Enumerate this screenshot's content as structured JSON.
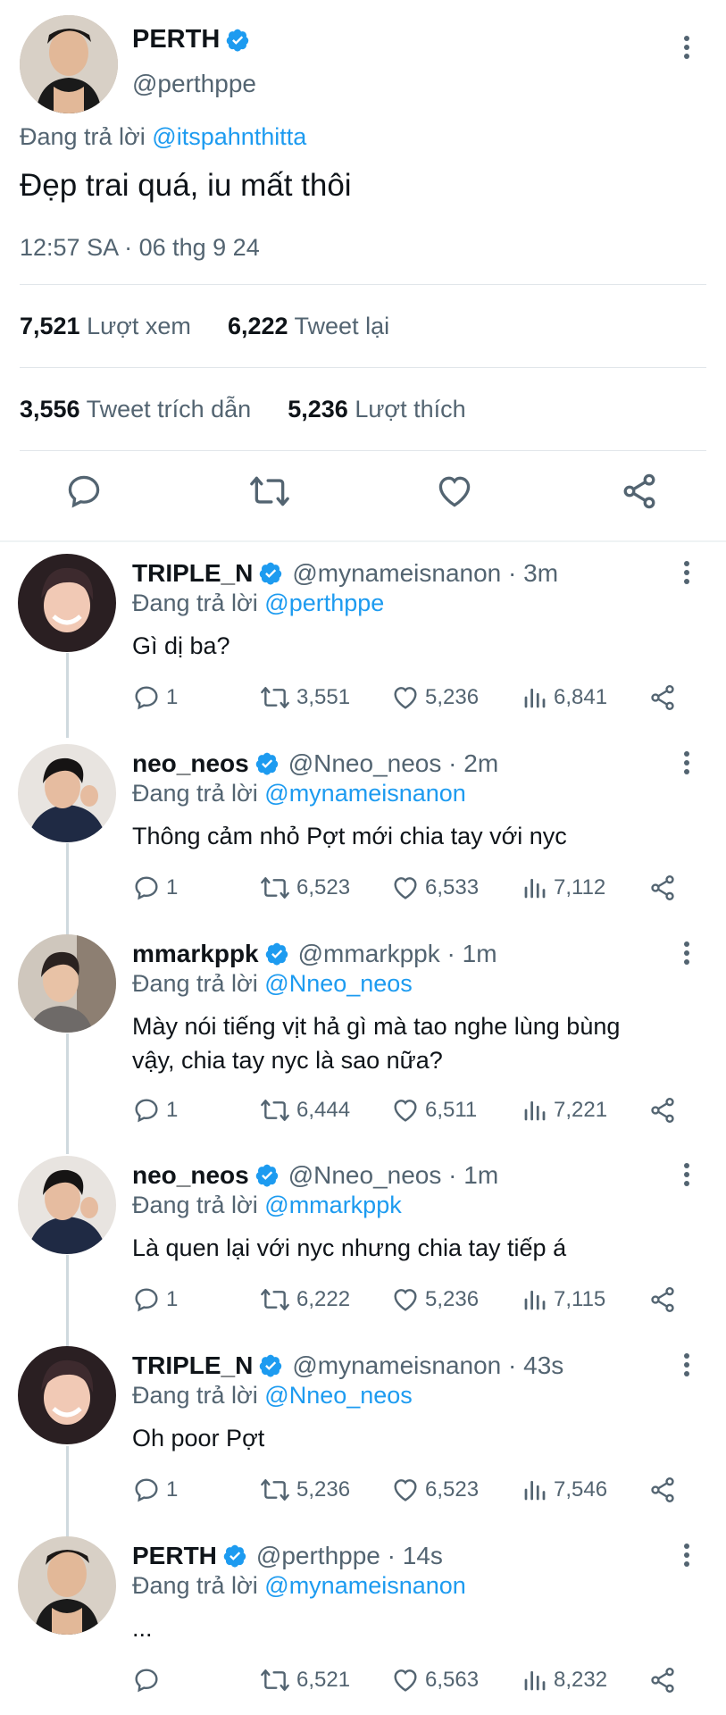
{
  "main": {
    "name": "PERTH",
    "handle": "@perthppe",
    "replying_prefix": "Đang trả lời",
    "replying_to": "@itspahnthitta",
    "text": "Đẹp trai quá, iu mất thôi",
    "timestamp": "12:57 SA · 06 thg 9 24",
    "views_count": "7,521",
    "views_label": "Lượt xem",
    "retweets_count": "6,222",
    "retweets_label": "Tweet lại",
    "quotes_count": "3,556",
    "quotes_label": "Tweet trích dẫn",
    "likes_count": "5,236",
    "likes_label": "Lượt thích"
  },
  "replies": [
    {
      "name": "TRIPLE_N",
      "handle": "@mynameisnanon",
      "time": "· 3m",
      "replying_prefix": "Đang trả lời",
      "replying_to": "@perthppe",
      "text": "Gì dị ba?",
      "comments": "1",
      "retweets": "3,551",
      "likes": "5,236",
      "views": "6,841"
    },
    {
      "name": "neo_neos",
      "handle": "@Nneo_neos",
      "time": "· 2m",
      "replying_prefix": "Đang trả lời",
      "replying_to": "@mynameisnanon",
      "text": "Thông cảm nhỏ Pợt mới chia tay với nyc",
      "comments": "1",
      "retweets": "6,523",
      "likes": "6,533",
      "views": "7,112"
    },
    {
      "name": "mmarkppk",
      "handle": "@mmarkppk",
      "time": "· 1m",
      "replying_prefix": "Đang trả lời",
      "replying_to": "@Nneo_neos",
      "text": "Mày nói tiếng vịt hả gì mà tao nghe lùng bùng vậy, chia tay nyc là sao nữa?",
      "comments": "1",
      "retweets": "6,444",
      "likes": "6,511",
      "views": "7,221"
    },
    {
      "name": "neo_neos",
      "handle": "@Nneo_neos",
      "time": "· 1m",
      "replying_prefix": "Đang trả lời",
      "replying_to": "@mmarkppk",
      "text": "Là quen lại với nyc nhưng chia tay tiếp á",
      "comments": "1",
      "retweets": "6,222",
      "likes": "5,236",
      "views": "7,115"
    },
    {
      "name": "TRIPLE_N",
      "handle": "@mynameisnanon",
      "time": "· 43s",
      "replying_prefix": "Đang trả lời",
      "replying_to": "@Nneo_neos",
      "text": "Oh poor Pợt",
      "comments": "1",
      "retweets": "5,236",
      "likes": "6,523",
      "views": "7,546"
    },
    {
      "name": "PERTH",
      "handle": "@perthppe",
      "time": "· 14s",
      "replying_prefix": "Đang trả lời",
      "replying_to": "@mynameisnanon",
      "text": "...",
      "comments": "",
      "retweets": "6,521",
      "likes": "6,563",
      "views": "8,232"
    }
  ],
  "colors": {
    "accent": "#1d9bf0",
    "text": "#0f1419",
    "secondary": "#536471"
  },
  "icons": [
    "verified-icon",
    "more-icon",
    "reply-icon",
    "retweet-icon",
    "like-icon",
    "views-icon",
    "share-icon"
  ]
}
